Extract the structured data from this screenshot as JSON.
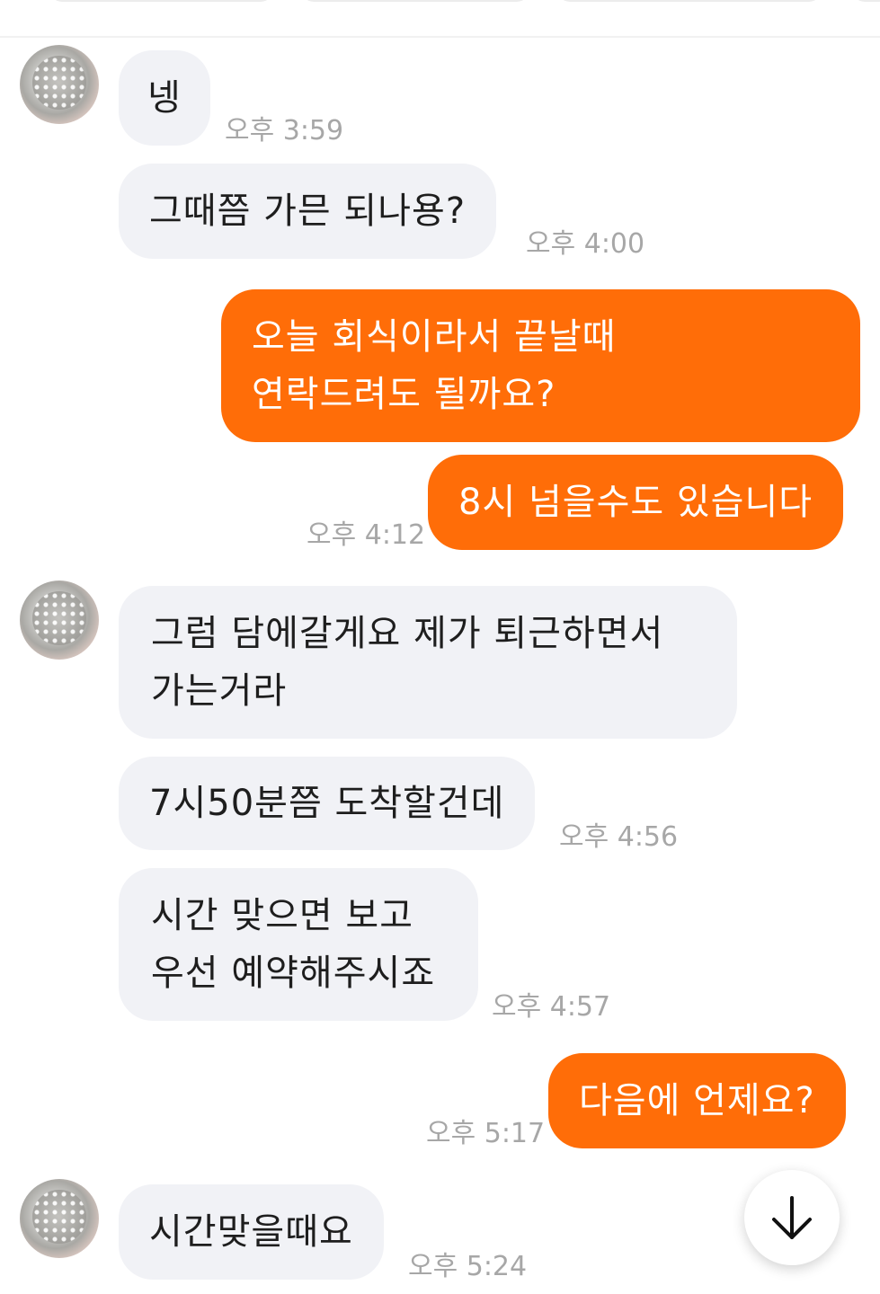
{
  "messages": [
    {
      "text": "넹",
      "time": ""
    },
    {
      "text": "그때쯤 가믄 되나용?",
      "time": "오후 3:59"
    },
    {
      "text": "오늘 회식이라서 끝날때\n연락드려도 될까요?",
      "time": "오후 4:00"
    },
    {
      "text": "8시 넘을수도 있습니다",
      "time": ""
    },
    {
      "text": "그럼 담에갈게요 제가 퇴근하면서\n가는거라",
      "time": "오후 4:12"
    },
    {
      "text": "7시50분쯤 도착할건데",
      "time": ""
    },
    {
      "text": "시간 맞으면 보고\n우선 예약해주시죠",
      "time": "오후 4:56"
    },
    {
      "text": "다음에 언제요?",
      "time": "오후 4:57"
    },
    {
      "text": "시간맞을때요",
      "time": "오후 5:17"
    }
  ],
  "times": {
    "t1": "오후 3:59",
    "t2": "오후 4:00",
    "t3": "오후 4:12",
    "t4": "오후 4:56",
    "t5": "오후 4:57",
    "t6": "오후 5:17",
    "t7": "오후 5:24"
  },
  "icons": {
    "scroll": "arrow-down-icon"
  },
  "colors": {
    "outgoing": "#ff6d08",
    "incoming": "#f1f2f6"
  }
}
